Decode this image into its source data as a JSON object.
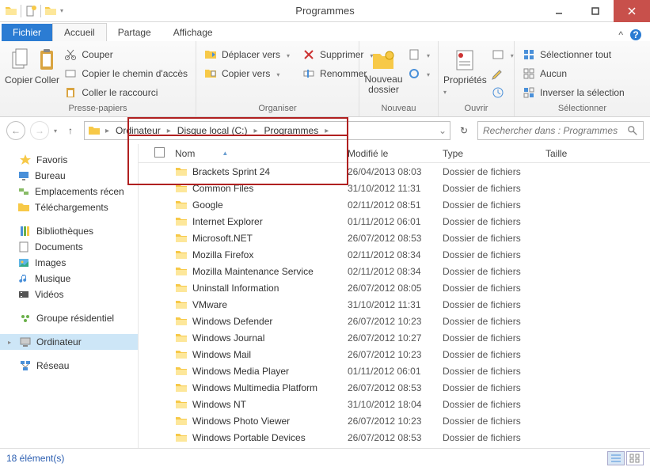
{
  "window": {
    "title": "Programmes"
  },
  "tabs": {
    "file": "Fichier",
    "home": "Accueil",
    "share": "Partage",
    "view": "Affichage"
  },
  "ribbon": {
    "clipboard": {
      "copy": "Copier",
      "paste": "Coller",
      "cut": "Couper",
      "copypath": "Copier le chemin d'accès",
      "pasteshortcut": "Coller le raccourci",
      "label": "Presse-papiers"
    },
    "organize": {
      "moveto": "Déplacer vers",
      "copyto": "Copier vers",
      "delete": "Supprimer",
      "rename": "Renommer",
      "label": "Organiser"
    },
    "new": {
      "newfolder": "Nouveau\ndossier",
      "label": "Nouveau"
    },
    "open": {
      "properties": "Propriétés",
      "label": "Ouvrir"
    },
    "select": {
      "selectall": "Sélectionner tout",
      "selectnone": "Aucun",
      "invert": "Inverser la sélection",
      "label": "Sélectionner"
    }
  },
  "breadcrumb": [
    "Ordinateur",
    "Disque local (C:)",
    "Programmes"
  ],
  "search": {
    "placeholder": "Rechercher dans : Programmes"
  },
  "columns": {
    "name": "Nom",
    "modified": "Modifié le",
    "type": "Type",
    "size": "Taille"
  },
  "nav": {
    "favorites": {
      "label": "Favoris",
      "items": [
        "Bureau",
        "Emplacements récen",
        "Téléchargements"
      ]
    },
    "libraries": {
      "label": "Bibliothèques",
      "items": [
        "Documents",
        "Images",
        "Musique",
        "Vidéos"
      ]
    },
    "homegroup": "Groupe résidentiel",
    "computer": "Ordinateur",
    "network": "Réseau"
  },
  "files": [
    {
      "name": "Brackets Sprint 24",
      "date": "26/04/2013 08:03",
      "type": "Dossier de fichiers"
    },
    {
      "name": "Common Files",
      "date": "31/10/2012 11:31",
      "type": "Dossier de fichiers"
    },
    {
      "name": "Google",
      "date": "02/11/2012 08:51",
      "type": "Dossier de fichiers"
    },
    {
      "name": "Internet Explorer",
      "date": "01/11/2012 06:01",
      "type": "Dossier de fichiers"
    },
    {
      "name": "Microsoft.NET",
      "date": "26/07/2012 08:53",
      "type": "Dossier de fichiers"
    },
    {
      "name": "Mozilla Firefox",
      "date": "02/11/2012 08:34",
      "type": "Dossier de fichiers"
    },
    {
      "name": "Mozilla Maintenance Service",
      "date": "02/11/2012 08:34",
      "type": "Dossier de fichiers"
    },
    {
      "name": "Uninstall Information",
      "date": "26/07/2012 08:05",
      "type": "Dossier de fichiers"
    },
    {
      "name": "VMware",
      "date": "31/10/2012 11:31",
      "type": "Dossier de fichiers"
    },
    {
      "name": "Windows Defender",
      "date": "26/07/2012 10:23",
      "type": "Dossier de fichiers"
    },
    {
      "name": "Windows Journal",
      "date": "26/07/2012 10:27",
      "type": "Dossier de fichiers"
    },
    {
      "name": "Windows Mail",
      "date": "26/07/2012 10:23",
      "type": "Dossier de fichiers"
    },
    {
      "name": "Windows Media Player",
      "date": "01/11/2012 06:01",
      "type": "Dossier de fichiers"
    },
    {
      "name": "Windows Multimedia Platform",
      "date": "26/07/2012 08:53",
      "type": "Dossier de fichiers"
    },
    {
      "name": "Windows NT",
      "date": "31/10/2012 18:04",
      "type": "Dossier de fichiers"
    },
    {
      "name": "Windows Photo Viewer",
      "date": "26/07/2012 10:23",
      "type": "Dossier de fichiers"
    },
    {
      "name": "Windows Portable Devices",
      "date": "26/07/2012 08:53",
      "type": "Dossier de fichiers"
    }
  ],
  "status": {
    "count": "18 élément(s)"
  }
}
